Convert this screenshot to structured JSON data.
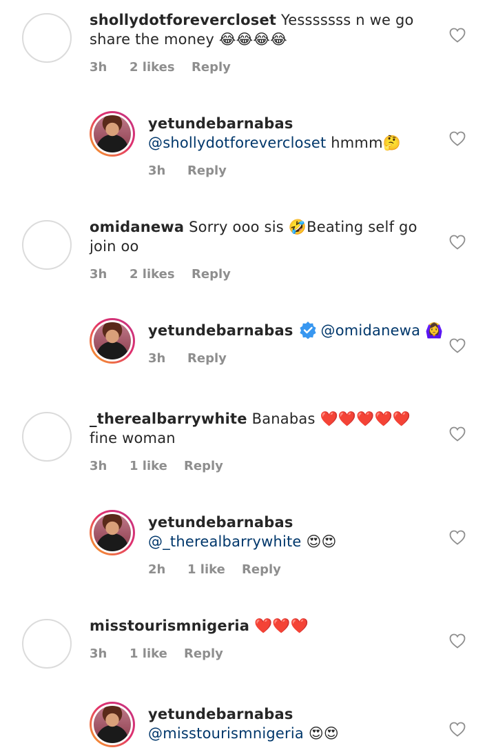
{
  "comments": [
    {
      "username": "shollydotforevercloset",
      "text": " Yesssssss n we go share the money 😂😂😂😂",
      "time": "3h",
      "likes": "2 likes",
      "reply": "Reply"
    },
    {
      "username": "yetundebarnabas",
      "mention": "@shollydotforevercloset",
      "text": " hmmm🤔",
      "time": "3h",
      "reply": "Reply"
    },
    {
      "username": "omidanewa",
      "text": " Sorry ooo sis 🤣Beating self go join oo",
      "time": "3h",
      "likes": "2 likes",
      "reply": "Reply"
    },
    {
      "username": "yetundebarnabas",
      "mention": "@omidanewa",
      "text": " 🙆‍♀️",
      "time": "3h",
      "reply": "Reply"
    },
    {
      "username": "_therealbarrywhite",
      "text": " Banabas ❤️❤️❤️❤️❤️ fine woman",
      "time": "3h",
      "likes": "1 like",
      "reply": "Reply"
    },
    {
      "username": "yetundebarnabas",
      "mention": "@_therealbarrywhite",
      "text": " 😍😍",
      "time": "2h",
      "likes": "1 like",
      "reply": "Reply"
    },
    {
      "username": "misstourismnigeria",
      "text": " ❤️❤️❤️",
      "time": "3h",
      "likes": "1 like",
      "reply": "Reply"
    },
    {
      "username": "yetundebarnabas",
      "mention": "@misstourismnigeria",
      "text": " 😍😍"
    }
  ],
  "colors": {
    "text": "#262626",
    "meta": "#8e8e8e",
    "mention": "#00376b",
    "verified": "#3897f0"
  },
  "icons": {
    "like": "heart-outline-icon",
    "verified": "verified-badge-icon"
  }
}
